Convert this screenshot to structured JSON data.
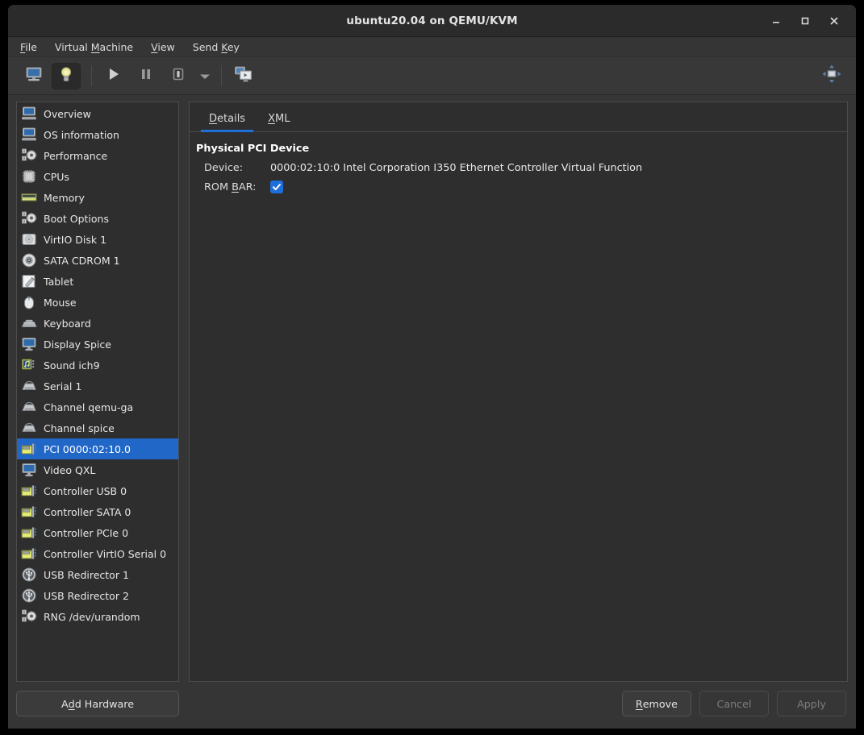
{
  "window": {
    "title": "ubuntu20.04 on QEMU/KVM",
    "controls": {
      "minimize": "minimize-window",
      "maximize": "maximize-window",
      "close": "close-window"
    }
  },
  "menubar": {
    "items": [
      {
        "label": "File",
        "mnemonic": "F"
      },
      {
        "label": "Virtual Machine",
        "mnemonic": "M"
      },
      {
        "label": "View",
        "mnemonic": "V"
      },
      {
        "label": "Send Key",
        "mnemonic": "K"
      }
    ]
  },
  "toolbar": {
    "buttons": [
      {
        "name": "show-console-view",
        "icon": "monitor-icon",
        "active": false
      },
      {
        "name": "show-hardware-details",
        "icon": "lightbulb-icon",
        "active": true
      },
      {
        "name": "run-vm",
        "icon": "play-icon",
        "active": false
      },
      {
        "name": "pause-vm",
        "icon": "pause-icon",
        "active": false
      },
      {
        "name": "shutdown-vm",
        "icon": "shutdown-icon",
        "active": false
      },
      {
        "name": "shutdown-options-dropdown",
        "icon": "chevron-down-icon",
        "active": false
      },
      {
        "name": "manage-snapshots",
        "icon": "snapshots-icon",
        "active": false
      }
    ],
    "right_button": {
      "name": "resize-to-vm",
      "icon": "resize-arrows-icon"
    }
  },
  "sidebar": {
    "items": [
      {
        "label": "Overview",
        "icon": "computer-icon"
      },
      {
        "label": "OS information",
        "icon": "computer-icon"
      },
      {
        "label": "Performance",
        "icon": "gears-icon"
      },
      {
        "label": "CPUs",
        "icon": "cpu-chip-icon"
      },
      {
        "label": "Memory",
        "icon": "memory-stick-icon"
      },
      {
        "label": "Boot Options",
        "icon": "gears-icon"
      },
      {
        "label": "VirtIO Disk 1",
        "icon": "harddisk-icon"
      },
      {
        "label": "SATA CDROM 1",
        "icon": "cdrom-icon"
      },
      {
        "label": "Tablet",
        "icon": "tablet-icon"
      },
      {
        "label": "Mouse",
        "icon": "mouse-icon"
      },
      {
        "label": "Keyboard",
        "icon": "keyboard-icon"
      },
      {
        "label": "Display Spice",
        "icon": "display-icon"
      },
      {
        "label": "Sound ich9",
        "icon": "sound-icon"
      },
      {
        "label": "Serial 1",
        "icon": "serial-port-icon"
      },
      {
        "label": "Channel qemu-ga",
        "icon": "serial-port-icon"
      },
      {
        "label": "Channel spice",
        "icon": "serial-port-icon"
      },
      {
        "label": "PCI 0000:02:10.0",
        "icon": "pci-card-icon",
        "selected": true
      },
      {
        "label": "Video QXL",
        "icon": "display-icon"
      },
      {
        "label": "Controller USB 0",
        "icon": "pci-card-icon"
      },
      {
        "label": "Controller SATA 0",
        "icon": "pci-card-icon"
      },
      {
        "label": "Controller PCIe 0",
        "icon": "pci-card-icon"
      },
      {
        "label": "Controller VirtIO Serial 0",
        "icon": "pci-card-icon"
      },
      {
        "label": "USB Redirector 1",
        "icon": "usb-icon"
      },
      {
        "label": "USB Redirector 2",
        "icon": "usb-icon"
      },
      {
        "label": "RNG /dev/urandom",
        "icon": "gears-icon"
      }
    ]
  },
  "detail": {
    "tabs": [
      {
        "label": "Details",
        "mnemonic": "D",
        "active": true
      },
      {
        "label": "XML",
        "mnemonic": "X",
        "active": false
      }
    ],
    "section_title": "Physical PCI Device",
    "fields": {
      "device_label": "Device:",
      "device_value": "0000:02:10:0 Intel Corporation I350 Ethernet Controller Virtual Function",
      "rombar_label_pre": "ROM ",
      "rombar_label_mnemonic": "B",
      "rombar_label_post": "AR:",
      "rombar_checked": true
    }
  },
  "footer": {
    "add_hardware": {
      "pre": "A",
      "mnemonic": "d",
      "post": "d Hardware",
      "enabled": true
    },
    "remove": {
      "mnemonic": "R",
      "post": "emove",
      "enabled": true
    },
    "cancel": {
      "label": "Cancel",
      "enabled": false
    },
    "apply": {
      "label": "Apply",
      "enabled": false
    }
  },
  "colors": {
    "selection_blue": "#2167c8",
    "accent_blue": "#1e6fd9",
    "window_bg": "#353535",
    "panel_bg": "#2e2e2e",
    "titlebar_bg": "#2b2b2b"
  }
}
